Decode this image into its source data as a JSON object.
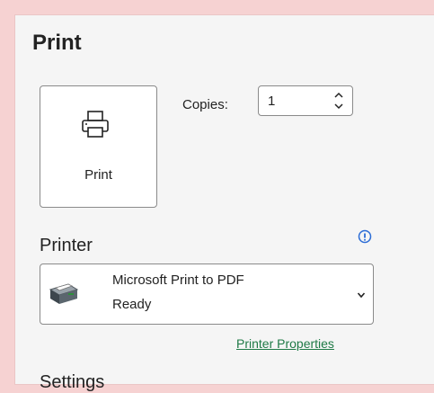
{
  "header": {
    "title": "Print"
  },
  "print_button": {
    "label": "Print",
    "icon": "printer-icon"
  },
  "copies": {
    "label": "Copies:",
    "value": "1"
  },
  "printer": {
    "section_title": "Printer",
    "info_icon": "info-icon",
    "selected_name": "Microsoft Print to PDF",
    "selected_status": "Ready",
    "properties_link": "Printer Properties"
  },
  "settings_peek": {
    "label": "Settings"
  },
  "colors": {
    "background": "#f6d2d2",
    "panel": "#f5f5f5",
    "link": "#1f7a46",
    "info": "#2b6cd6"
  }
}
